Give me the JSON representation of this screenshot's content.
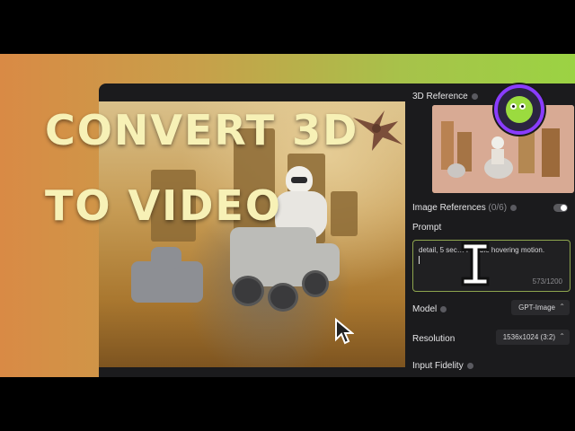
{
  "overlay": {
    "line1": "CONVERT 3D",
    "line2": "TO VIDEO"
  },
  "panel": {
    "reference_label": "3D Reference",
    "image_refs_label": "Image References",
    "image_refs_count": "(0/6)",
    "prompt_label": "Prompt",
    "prompt_text": "detail, 5 sec… f stable hovering motion.",
    "prompt_counter": "573/1200",
    "model_label": "Model",
    "model_value": "GPT-Image",
    "resolution_label": "Resolution",
    "resolution_value": "1536x1024 (3:2)",
    "input_fidelity_label": "Input Fidelity"
  },
  "colors": {
    "accent_border": "#8ea54e",
    "title_text": "#f7f1b6",
    "logo_ring": "#8a3cff",
    "logo_face": "#9bdb3f"
  },
  "icons": {
    "logo": "mushroom-mascot-icon",
    "pointer": "mouse-pointer-icon",
    "ibeam": "text-ibeam-icon"
  }
}
